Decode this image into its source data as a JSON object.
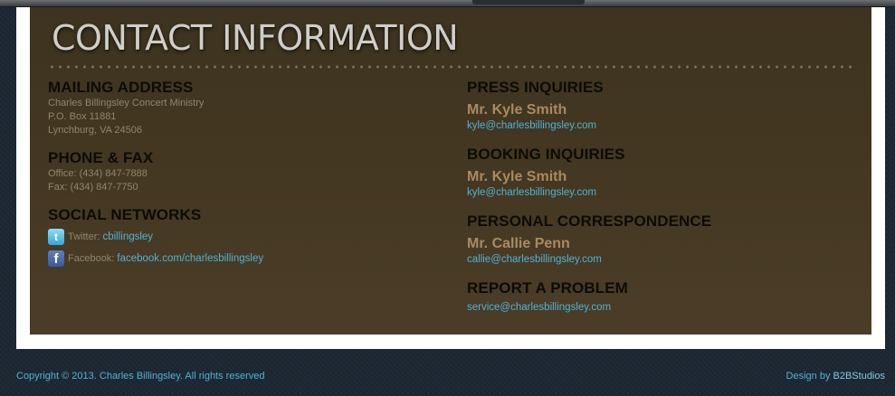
{
  "title": "CONTACT INFORMATION",
  "mailing": {
    "heading": "MAILING ADDRESS",
    "lines": [
      "Charles Billingsley Concert Ministry",
      "P.O. Box 11881",
      "Lynchburg, VA 24506"
    ]
  },
  "phone": {
    "heading": "PHONE & FAX",
    "office": "Office: (434) 847-7888",
    "fax": "Fax: (434) 847-7750"
  },
  "social": {
    "heading": "SOCIAL NETWORKS",
    "twitter_label": "Twitter:",
    "twitter_link": "cbillingsley",
    "twitter_icon": "twitter-icon",
    "facebook_label": "Facebook:",
    "facebook_link": "facebook.com/charlesbillingsley",
    "facebook_icon": "facebook-icon"
  },
  "press": {
    "heading": "PRESS INQUIRIES",
    "name": "Mr. Kyle Smith",
    "email": "kyle@charlesbillingsley.com"
  },
  "booking": {
    "heading": "BOOKING INQUIRIES",
    "name": "Mr. Kyle Smith",
    "email": "kyle@charlesbillingsley.com"
  },
  "personal": {
    "heading": "PERSONAL CORRESPONDENCE",
    "name": "Mr. Callie Penn",
    "email": "callie@charlesbillingsley.com"
  },
  "report": {
    "heading": "REPORT A PROBLEM",
    "email": "service@charlesbillingsley.com"
  },
  "footer": {
    "copyright": "Copyright © 2013. Charles Billingsley. All rights reserved",
    "design_prefix": "Design by",
    "design_brand": "B2BStudios"
  },
  "colors": {
    "panel": "#453822",
    "heading": "#0d0b07",
    "name": "#a88a61",
    "link": "#4fb2d6",
    "body_text": "#8f8570",
    "page_bg": "#1d2733"
  }
}
